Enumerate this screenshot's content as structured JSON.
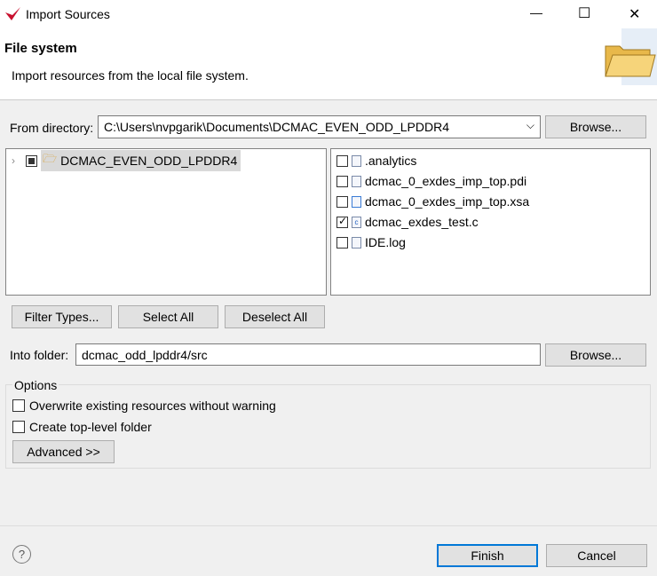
{
  "window": {
    "title": "Import Sources",
    "minimize": "—",
    "maximize": "☐",
    "close": "✕"
  },
  "header": {
    "title": "File system",
    "description": "Import resources from the local file system."
  },
  "from_directory": {
    "label": "From directory:",
    "value": "C:\\Users\\nvpgarik\\Documents\\DCMAC_EVEN_ODD_LPDDR4",
    "browse": "Browse..."
  },
  "tree": {
    "items": [
      {
        "label": "DCMAC_EVEN_ODD_LPDDR4",
        "state": "partial",
        "expanded": false
      }
    ]
  },
  "files": [
    {
      "label": ".analytics",
      "checked": false,
      "icon": "file-icon"
    },
    {
      "label": "dcmac_0_exdes_imp_top.pdi",
      "checked": false,
      "icon": "file-icon"
    },
    {
      "label": "dcmac_0_exdes_imp_top.xsa",
      "checked": false,
      "icon": "xsa-file-icon"
    },
    {
      "label": "dcmac_exdes_test.c",
      "checked": true,
      "icon": "c-file-icon"
    },
    {
      "label": "IDE.log",
      "checked": false,
      "icon": "file-icon"
    }
  ],
  "buttons": {
    "filter_types": "Filter Types...",
    "select_all": "Select All",
    "deselect_all": "Deselect All",
    "browse2": "Browse...",
    "advanced": "Advanced >>",
    "finish": "Finish",
    "cancel": "Cancel",
    "help": "?"
  },
  "into_folder": {
    "label": "Into folder:",
    "value": "dcmac_odd_lpddr4/src"
  },
  "options": {
    "title": "Options",
    "overwrite": "Overwrite existing resources without warning",
    "overwrite_checked": false,
    "create_top": "Create top-level folder",
    "create_top_checked": false
  }
}
